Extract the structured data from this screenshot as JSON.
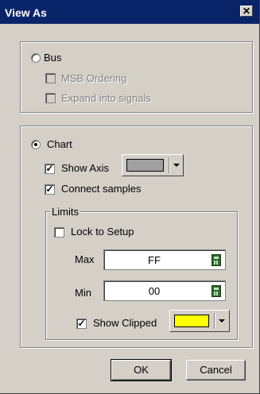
{
  "window": {
    "title": "View As",
    "close_glyph": "✕"
  },
  "bus_group": {
    "radio_label": "Bus",
    "msb_label": "MSB Ordering",
    "expand_label": "Expand into signals"
  },
  "chart_group": {
    "radio_label": "Chart",
    "show_axis_label": "Show Axis",
    "axis_color": "#a0a0a0",
    "connect_samples_label": "Connect samples",
    "limits": {
      "legend": "Limits",
      "lock_label": "Lock to Setup",
      "max_label": "Max",
      "max_value": "FF",
      "min_label": "Min",
      "min_value": "00",
      "show_clipped_label": "Show Clipped",
      "clipped_color": "#ffff00"
    }
  },
  "buttons": {
    "ok": "OK",
    "cancel": "Cancel"
  },
  "check_glyph": "✓"
}
